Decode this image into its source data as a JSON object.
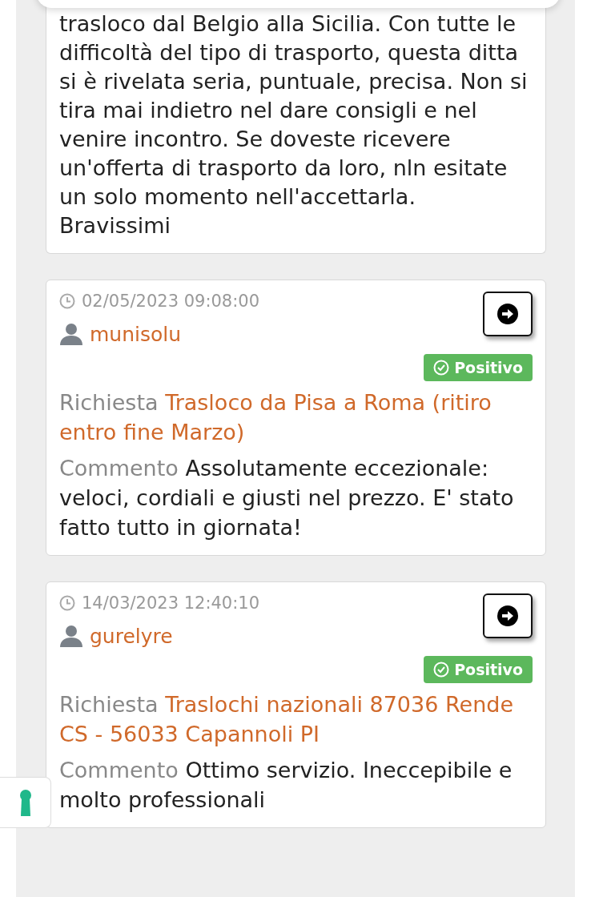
{
  "previous_review": {
    "comment": "trasloco dal Belgio alla Sicilia. Con tutte le difficoltà del tipo di trasporto, questa ditta si è rivelata seria, puntuale, precisa. Non si tira mai indietro nel dare consigli e nel venire incontro. Se doveste ricevere un'offerta di trasporto da loro, nln esitate un solo momento nell'accettarla. Bravissimi"
  },
  "reviews": [
    {
      "date": "02/05/2023 09:08:00",
      "user": "munisolu",
      "rating": {
        "kind": "positive",
        "label": "Positivo"
      },
      "request_label": "Richiesta",
      "request": "Trasloco da Pisa a Roma (ritiro entro fine Marzo)",
      "comment_label": "Commento",
      "comment": "Assolutamente eccezionale: veloci, cordiali e giusti nel prezzo. E' stato fatto tutto in giornata!"
    },
    {
      "date": "14/03/2023 12:40:10",
      "user": "gurelyre",
      "rating": {
        "kind": "positive",
        "label": "Positivo"
      },
      "request_label": "Richiesta",
      "request": "Traslochi nazionali 87036 Rende CS - 56033 Capannoli PI",
      "comment_label": "Commento",
      "comment": "Ottimo servizio. Ineccepibile e molto professionali"
    }
  ]
}
